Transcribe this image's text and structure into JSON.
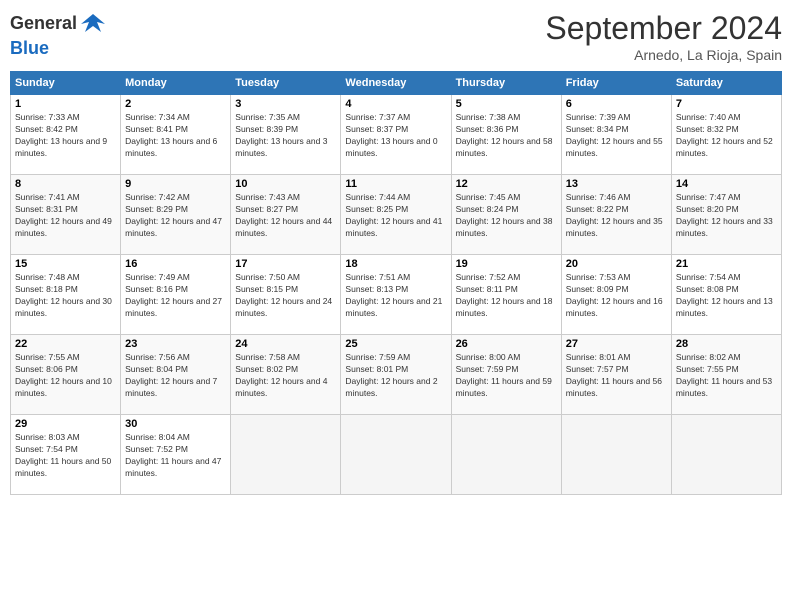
{
  "header": {
    "logo_line1": "General",
    "logo_line2": "Blue",
    "month": "September 2024",
    "location": "Arnedo, La Rioja, Spain"
  },
  "columns": [
    "Sunday",
    "Monday",
    "Tuesday",
    "Wednesday",
    "Thursday",
    "Friday",
    "Saturday"
  ],
  "weeks": [
    [
      {
        "day": 1,
        "sunrise": "7:33 AM",
        "sunset": "8:42 PM",
        "daylight": "13 hours and 9 minutes."
      },
      {
        "day": 2,
        "sunrise": "7:34 AM",
        "sunset": "8:41 PM",
        "daylight": "13 hours and 6 minutes."
      },
      {
        "day": 3,
        "sunrise": "7:35 AM",
        "sunset": "8:39 PM",
        "daylight": "13 hours and 3 minutes."
      },
      {
        "day": 4,
        "sunrise": "7:37 AM",
        "sunset": "8:37 PM",
        "daylight": "13 hours and 0 minutes."
      },
      {
        "day": 5,
        "sunrise": "7:38 AM",
        "sunset": "8:36 PM",
        "daylight": "12 hours and 58 minutes."
      },
      {
        "day": 6,
        "sunrise": "7:39 AM",
        "sunset": "8:34 PM",
        "daylight": "12 hours and 55 minutes."
      },
      {
        "day": 7,
        "sunrise": "7:40 AM",
        "sunset": "8:32 PM",
        "daylight": "12 hours and 52 minutes."
      }
    ],
    [
      {
        "day": 8,
        "sunrise": "7:41 AM",
        "sunset": "8:31 PM",
        "daylight": "12 hours and 49 minutes."
      },
      {
        "day": 9,
        "sunrise": "7:42 AM",
        "sunset": "8:29 PM",
        "daylight": "12 hours and 47 minutes."
      },
      {
        "day": 10,
        "sunrise": "7:43 AM",
        "sunset": "8:27 PM",
        "daylight": "12 hours and 44 minutes."
      },
      {
        "day": 11,
        "sunrise": "7:44 AM",
        "sunset": "8:25 PM",
        "daylight": "12 hours and 41 minutes."
      },
      {
        "day": 12,
        "sunrise": "7:45 AM",
        "sunset": "8:24 PM",
        "daylight": "12 hours and 38 minutes."
      },
      {
        "day": 13,
        "sunrise": "7:46 AM",
        "sunset": "8:22 PM",
        "daylight": "12 hours and 35 minutes."
      },
      {
        "day": 14,
        "sunrise": "7:47 AM",
        "sunset": "8:20 PM",
        "daylight": "12 hours and 33 minutes."
      }
    ],
    [
      {
        "day": 15,
        "sunrise": "7:48 AM",
        "sunset": "8:18 PM",
        "daylight": "12 hours and 30 minutes."
      },
      {
        "day": 16,
        "sunrise": "7:49 AM",
        "sunset": "8:16 PM",
        "daylight": "12 hours and 27 minutes."
      },
      {
        "day": 17,
        "sunrise": "7:50 AM",
        "sunset": "8:15 PM",
        "daylight": "12 hours and 24 minutes."
      },
      {
        "day": 18,
        "sunrise": "7:51 AM",
        "sunset": "8:13 PM",
        "daylight": "12 hours and 21 minutes."
      },
      {
        "day": 19,
        "sunrise": "7:52 AM",
        "sunset": "8:11 PM",
        "daylight": "12 hours and 18 minutes."
      },
      {
        "day": 20,
        "sunrise": "7:53 AM",
        "sunset": "8:09 PM",
        "daylight": "12 hours and 16 minutes."
      },
      {
        "day": 21,
        "sunrise": "7:54 AM",
        "sunset": "8:08 PM",
        "daylight": "12 hours and 13 minutes."
      }
    ],
    [
      {
        "day": 22,
        "sunrise": "7:55 AM",
        "sunset": "8:06 PM",
        "daylight": "12 hours and 10 minutes."
      },
      {
        "day": 23,
        "sunrise": "7:56 AM",
        "sunset": "8:04 PM",
        "daylight": "12 hours and 7 minutes."
      },
      {
        "day": 24,
        "sunrise": "7:58 AM",
        "sunset": "8:02 PM",
        "daylight": "12 hours and 4 minutes."
      },
      {
        "day": 25,
        "sunrise": "7:59 AM",
        "sunset": "8:01 PM",
        "daylight": "12 hours and 2 minutes."
      },
      {
        "day": 26,
        "sunrise": "8:00 AM",
        "sunset": "7:59 PM",
        "daylight": "11 hours and 59 minutes."
      },
      {
        "day": 27,
        "sunrise": "8:01 AM",
        "sunset": "7:57 PM",
        "daylight": "11 hours and 56 minutes."
      },
      {
        "day": 28,
        "sunrise": "8:02 AM",
        "sunset": "7:55 PM",
        "daylight": "11 hours and 53 minutes."
      }
    ],
    [
      {
        "day": 29,
        "sunrise": "8:03 AM",
        "sunset": "7:54 PM",
        "daylight": "11 hours and 50 minutes."
      },
      {
        "day": 30,
        "sunrise": "8:04 AM",
        "sunset": "7:52 PM",
        "daylight": "11 hours and 47 minutes."
      },
      null,
      null,
      null,
      null,
      null
    ]
  ]
}
